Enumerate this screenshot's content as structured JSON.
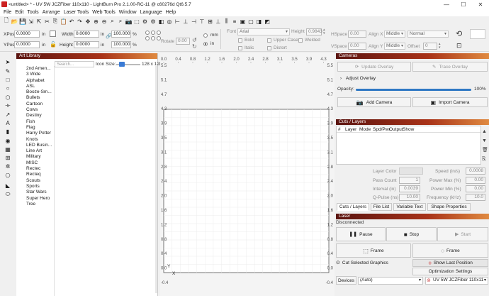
{
  "window": {
    "title": "<untitled> * - UV 5W JCZFiber 110x110 - LightBurn Pro 2.1.00-RC-11 @ c60276d Qt6.5.7",
    "controls": [
      "—",
      "☐",
      "✕"
    ]
  },
  "menu": [
    "File",
    "Edit",
    "Tools",
    "Arrange",
    "Laser Tools",
    "Web Tools",
    "Window",
    "Language",
    "Help"
  ],
  "numeric_bar": {
    "xpos_label": "XPos",
    "xpos_value": "0.0000",
    "xpos_unit": "in",
    "ypos_label": "YPos",
    "ypos_value": "0.0000",
    "ypos_unit": "in",
    "width_label": "Width",
    "width_value": "0.0000",
    "width_unit": "in",
    "height_label": "Height",
    "height_value": "0.0000",
    "height_unit": "in",
    "scale_x": "100.000",
    "scale_y": "100.000",
    "percent": "%",
    "rotate_label": "Rotate",
    "rotate_value": "0.00",
    "unit_mm": "mm",
    "unit_in": "in",
    "font_label": "Font",
    "font_value": "Arial",
    "text_height_label": "Height",
    "text_height_value": "0.9843",
    "bold": "Bold",
    "italic": "Italic",
    "upper_case": "Upper Case",
    "distort": "Distort",
    "welded": "Welded",
    "hspace_label": "HSpace",
    "hspace_value": "0.00",
    "vspace_label": "VSpace",
    "vspace_value": "0.00",
    "align_x_label": "Align X",
    "align_x_value": "Middle",
    "align_y_label": "Align Y",
    "align_y_value": "Middle",
    "normal_value": "Normal",
    "offset_label": "Offset",
    "offset_value": "0"
  },
  "art_library": {
    "title": "Art Library",
    "search_placeholder": "Search...",
    "icon_size_label": "Icon Size:",
    "icon_size_value": "128 x 128",
    "items": [
      "2nd Amen...",
      "3 Wide",
      "Alphabet",
      "ASL",
      "Booze-Sm...",
      "Bullets",
      "Cartoon",
      "Cows",
      "Destiny",
      "Fish",
      "Flag",
      "Harry Potter",
      "Knots",
      "LED Busin...",
      "Line Art",
      "Military",
      "MISC",
      "Rectec",
      "Recteq",
      "Scouts",
      "Sports",
      "Star Wars",
      "Super Hero",
      "Tree"
    ]
  },
  "ruler": {
    "top_ticks": [
      "0.0",
      "0.4",
      "0.8",
      "1.2",
      "1.6",
      "2.0",
      "2.4",
      "2.8",
      "3.1",
      "3.5",
      "3.9",
      "4.3"
    ],
    "left_ticks": [
      "5.5",
      "5.1",
      "4.7",
      "4.3",
      "3.9",
      "3.5",
      "3.1",
      "2.8",
      "2.4",
      "2.0",
      "1.6",
      "1.2",
      "0.8",
      "0.4",
      "0.0",
      "-0.4"
    ],
    "right_ticks": [
      "5.5",
      "5.1",
      "4.7",
      "4.3",
      "3.9",
      "3.5",
      "3.1",
      "2.8",
      "2.4",
      "2.0",
      "1.6",
      "1.2",
      "0.8",
      "0.4",
      "0.0",
      "-0.4"
    ],
    "x_axis_label": "X",
    "y_axis_label": "Y"
  },
  "cameras": {
    "title": "Cameras",
    "update_overlay": "Update Overlay",
    "trace_overlay": "Trace Overlay",
    "adjust_overlay": "Adjust Overlay",
    "opacity_label": "Opacity:",
    "opacity_value": "100%",
    "opacity_fraction": 1.0,
    "add_camera": "Add Camera",
    "import_camera": "Import Camera"
  },
  "cuts": {
    "title": "Cuts / Layers",
    "columns": [
      "#",
      "Layer",
      "Mode",
      "Spd/Pwr",
      "Output",
      "Show"
    ],
    "layer_color_label": "Layer Color",
    "pass_count_label": "Pass Count",
    "pass_count_value": "1",
    "interval_label": "Interval (in)",
    "interval_value": "0.0039",
    "qpulse_label": "Q-Pulse (ns)",
    "qpulse_value": "10.00",
    "speed_label": "Speed (in/s)",
    "speed_value": "0.0008",
    "power_max_label": "Power Max (%)",
    "power_max_value": "0.00",
    "power_min_label": "Power Min (%)",
    "power_min_value": "0.00",
    "frequency_label": "Frequency (kHz)",
    "frequency_value": "10.0",
    "tabs": [
      "Cuts / Layers",
      "File List",
      "Variable Text",
      "Shape Properties"
    ]
  },
  "laser": {
    "title": "Laser",
    "status": "Disconnected",
    "pause": "Pause",
    "stop": "Stop",
    "start": "Start",
    "frame1": "Frame",
    "frame2": "Frame",
    "cut_selected": "Cut Selected Graphics",
    "show_last_position": "Show Last Position",
    "optimization_settings": "Optimization Settings",
    "devices": "Devices",
    "devices_value": "(Auto)",
    "device_name": "UV 5W JCZFiber 110x11"
  }
}
